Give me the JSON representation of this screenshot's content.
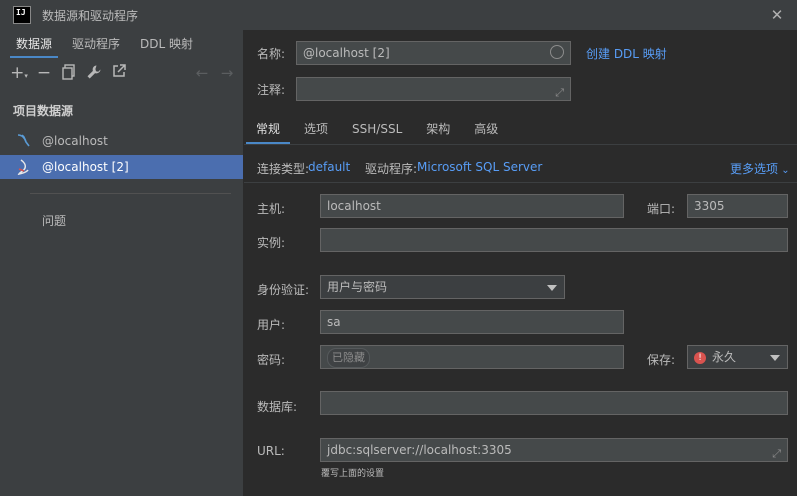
{
  "window": {
    "title": "数据源和驱动程序",
    "logo_text": "IJ"
  },
  "left_tabs": [
    {
      "label": "数据源"
    },
    {
      "label": "驱动程序"
    },
    {
      "label": "DDL 映射"
    }
  ],
  "toolbar_icons": [
    "add-icon",
    "remove-icon",
    "copy-icon",
    "wrench-icon",
    "navigate-icon",
    "back-arrow-icon",
    "forward-arrow-icon"
  ],
  "section_title": "项目数据源",
  "data_sources": [
    {
      "label": "@localhost",
      "icon": "mysql-icon"
    },
    {
      "label": "@localhost [2]",
      "icon": "sqlserver-icon"
    }
  ],
  "problems_label": "问题",
  "form": {
    "name_label": "名称:",
    "name_value": "@localhost [2]",
    "create_ddl_link": "创建 DDL 映射",
    "comment_label": "注释:",
    "comment_value": "",
    "subtabs": [
      {
        "label": "常规"
      },
      {
        "label": "选项"
      },
      {
        "label": "SSH/SSL"
      },
      {
        "label": "架构"
      },
      {
        "label": "高级"
      }
    ],
    "conn_type_label": "连接类型:",
    "conn_type_value": "default",
    "driver_label": "驱动程序:",
    "driver_value": "Microsoft SQL Server",
    "more_options": "更多选项",
    "host_label": "主机:",
    "host_value": "localhost",
    "port_label": "端口:",
    "port_value": "3305",
    "instance_label": "实例:",
    "instance_value": "",
    "auth_label": "身份验证:",
    "auth_value": "用户与密码",
    "user_label": "用户:",
    "user_value": "sa",
    "password_label": "密码:",
    "password_value": "已隐藏",
    "save_label": "保存:",
    "save_value": "永久",
    "database_label": "数据库:",
    "database_value": "",
    "url_label": "URL:",
    "url_value": "jdbc:sqlserver://localhost:3305",
    "url_hint": "覆写上面的设置"
  }
}
